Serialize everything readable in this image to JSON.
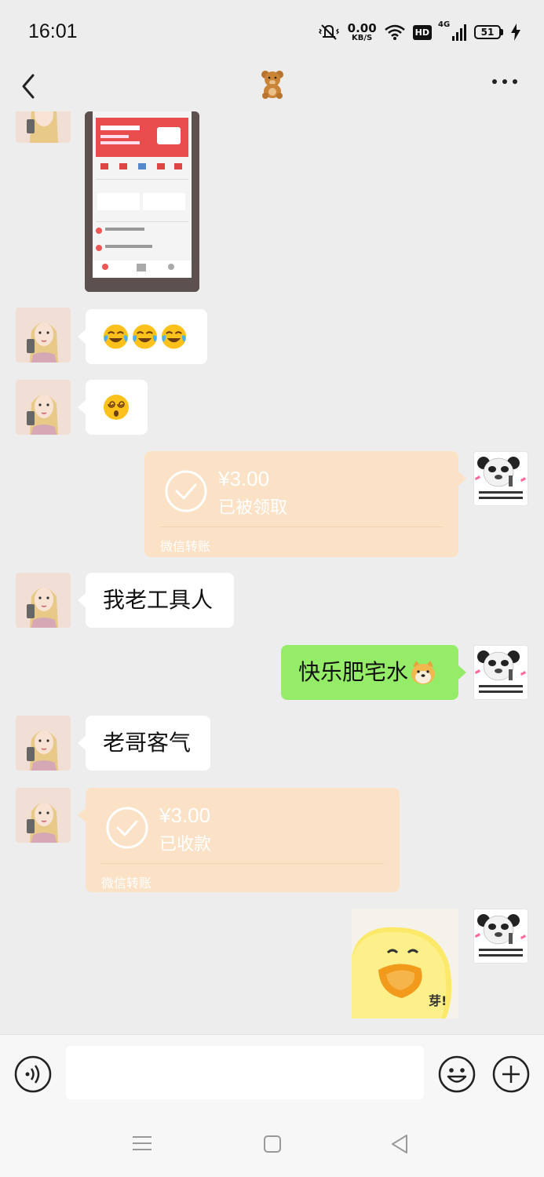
{
  "status_bar": {
    "time": "16:01",
    "net_speed_value": "0.00",
    "net_speed_unit": "KB/S",
    "hd_badge": "HD",
    "network_type": "4G",
    "battery_level": "51"
  },
  "nav": {
    "title_icon": "teddy-bear-icon"
  },
  "messages": [
    {
      "side": "left",
      "type": "image",
      "description_icon": "phone-screenshot-image"
    },
    {
      "side": "left",
      "type": "text",
      "emojis": [
        "crying-laughing",
        "crying-laughing",
        "crying-laughing"
      ]
    },
    {
      "side": "left",
      "type": "text",
      "emojis": [
        "dizzy-face"
      ]
    },
    {
      "side": "right",
      "type": "transfer",
      "amount": "¥3.00",
      "status": "已被领取",
      "footer": "微信转账"
    },
    {
      "side": "left",
      "type": "text",
      "text": "我老工具人"
    },
    {
      "side": "right",
      "type": "text",
      "text": "快乐肥宅水",
      "emojis": [
        "doge"
      ]
    },
    {
      "side": "left",
      "type": "text",
      "text": "老哥客气"
    },
    {
      "side": "left",
      "type": "transfer",
      "amount": "¥3.00",
      "status": "已收款",
      "footer": "微信转账"
    },
    {
      "side": "right",
      "type": "sticker",
      "sticker_text": "芽!"
    }
  ],
  "colors": {
    "background": "#ededed",
    "green_bubble": "#95ec69",
    "transfer_bubble": "#fbe2c6"
  },
  "input_bar": {
    "voice_icon": "voice-icon",
    "emoji_icon": "emoji-icon",
    "plus_icon": "plus-icon"
  }
}
